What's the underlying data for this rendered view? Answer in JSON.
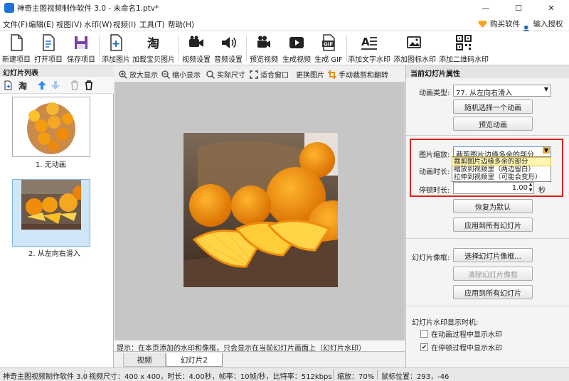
{
  "window": {
    "title": "神奇主图视频制作软件 3.0 - 未命名1.ptv*",
    "controls": {
      "minimize": "—",
      "maximize": "☐",
      "close": "✕"
    }
  },
  "menu": {
    "items": [
      "文件(F)",
      "编辑(E)",
      "视图(V)",
      "水印(W)",
      "视频(I)",
      "工具(T)",
      "帮助(H)"
    ],
    "buy": "购买软件",
    "register": "输入授权码"
  },
  "toolbar": {
    "new_project": "新建项目",
    "open_project": "打开项目",
    "save_project": "保存项目",
    "add_image": "添加图片",
    "load_taobao": "加载宝贝图片",
    "video_settings": "视频设置",
    "audio_settings": "音频设置",
    "preview_video": "预览视频",
    "generate_video": "生成视频",
    "generate_gif": "生成 GIF",
    "add_text_watermark": "添加文字水印",
    "add_image_watermark": "添加图标水印",
    "add_qr_watermark": "添加二维码水印"
  },
  "slides": {
    "header": "幻灯片列表",
    "tool_tao": "淘",
    "items": [
      {
        "label": "1. 无动画"
      },
      {
        "label": "2. 从左向右滑入"
      }
    ]
  },
  "canvas_toolbar": {
    "zoom_in": "放大显示",
    "zoom_out": "缩小显示",
    "actual_size": "实际尺寸",
    "fit_window": "适合窗口",
    "replace_image": "更换图片",
    "manual_crop": "手动裁剪和翻转"
  },
  "hint": "提示：在本页添加的水印和像框，只会显示在当前幻灯片画面上（幻灯片水印）",
  "tabs": {
    "video": "视频",
    "slide": "幻灯片2"
  },
  "properties": {
    "header": "当前幻灯片属性",
    "animation_type_label": "动画类型:",
    "animation_type_value": "77. 从左向右滑入",
    "random_animation": "随机选择一个动画",
    "preview_animation": "预览动画",
    "image_scale_label": "图片缩放:",
    "image_scale_value": "裁剪图片边缘多余的部分",
    "image_scale_options": [
      "裁剪图片边缘多余的部分",
      "缩放到视频里（两边留白）",
      "拉伸到视频里（可能会变形）"
    ],
    "animation_duration_label": "动画时长:",
    "pause_duration_label": "停顿时长:",
    "pause_duration_value": "1.00",
    "pause_unit": "秒",
    "restore_default": "恢复为默认",
    "apply_all_1": "应用到所有幻灯片",
    "frame_label": "幻灯片像框:",
    "choose_frame": "选择幻灯片像框...",
    "clear_frame": "清除幻灯片像框",
    "apply_all_2": "应用到所有幻灯片",
    "watermark_timing_label": "幻灯片水印显示时机:",
    "show_during_animation": "在动画过程中显示水印",
    "show_during_animation_checked": false,
    "show_during_pause": "在停顿过程中显示水印",
    "show_during_pause_checked": true
  },
  "status": {
    "app": "神奇主图视频制作软件 3.0",
    "video_info": "视频尺寸：400 x 400，时长：4.00秒，帧率：10帧/秒，比特率：512kbps",
    "zoom": "缩放：70%",
    "mouse": "鼠标位置：293，-46"
  },
  "colors": {
    "accent_blue": "#1e73d8",
    "highlight_red": "#e02020",
    "orange": "#f39c12"
  }
}
